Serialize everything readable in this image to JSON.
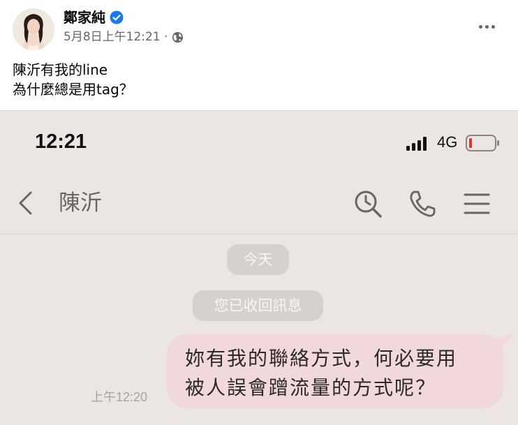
{
  "post": {
    "author": "鄭家純",
    "meta": "5月8日上午12:21 ·",
    "text_lines": [
      "陳沂有我的line",
      "為什麼總是用tag？"
    ]
  },
  "phone": {
    "status": {
      "time": "12:21",
      "network": "4G"
    },
    "chat": {
      "contact": "陳沂",
      "date_pill": "今天",
      "system_notice": "您已收回訊息",
      "message_time": "上午12:20",
      "message_lines": [
        "妳有我的聯絡方式，何必要用",
        "被人誤會蹭流量的方式呢？"
      ]
    }
  },
  "icons": {
    "verified": "verified-badge-icon",
    "privacy": "globe-icon",
    "more": "more-options-icon",
    "back": "chevron-left-icon",
    "search": "search-icon",
    "call": "phone-icon",
    "menu": "hamburger-menu-icon"
  },
  "colors": {
    "verified_blue": "#1877f2",
    "bubble": "#f1d8dc",
    "screenshot_bg": "#ebe6e3",
    "battery_low": "#e0352b"
  }
}
